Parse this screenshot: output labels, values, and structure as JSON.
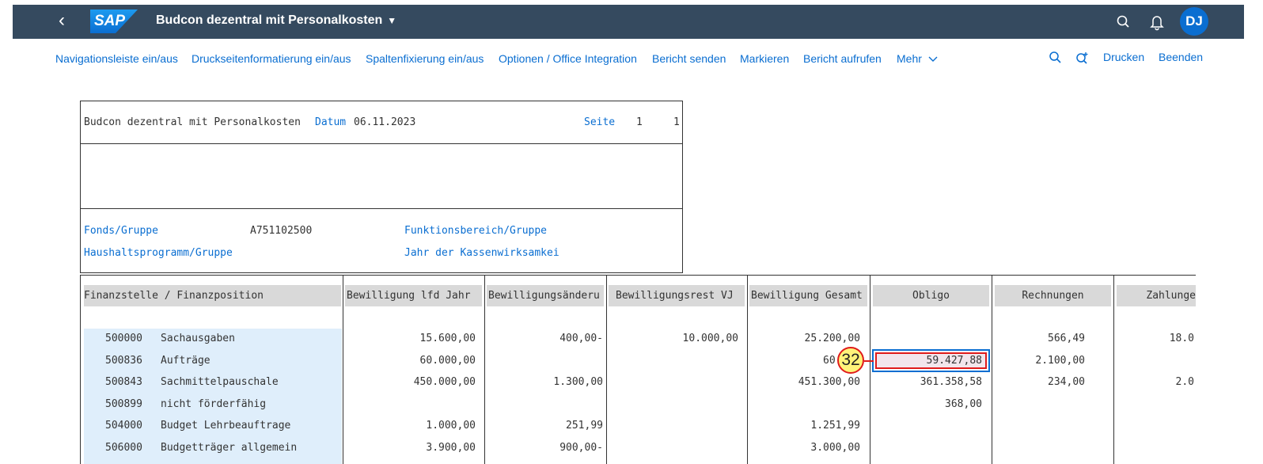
{
  "shell": {
    "logo_text": "SAP",
    "app_title": "Budcon dezentral mit Personalkosten",
    "user_initials": "DJ",
    "colors": {
      "shell_bg": "#354a5f",
      "avatar_bg": "#0a6ed1"
    }
  },
  "toolbar": {
    "items": [
      "Navigationsleiste ein/aus",
      "Druckseitenformatierung ein/aus",
      "Spaltenfixierung ein/aus",
      "Optionen / Office Integration",
      "Bericht senden",
      "Markieren",
      "Bericht aufrufen"
    ],
    "more_label": "Mehr",
    "print_label": "Drucken",
    "exit_label": "Beenden"
  },
  "report_header": {
    "title": "Budcon dezentral mit Personalkosten",
    "date_label": "Datum",
    "date_value": "06.11.2023",
    "page_label": "Seite",
    "page_current": "1",
    "page_total": "1",
    "fund_label": "Fonds/Gruppe",
    "fund_value": "A751102500",
    "functional_area_label": "Funktionsbereich/Gruppe",
    "budget_program_label": "Haushaltsprogramm/Gruppe",
    "cash_year_label": "Jahr der Kassenwirksamkei"
  },
  "table": {
    "columns": [
      "Finanzstelle / Finanzposition",
      "Bewilligung lfd Jahr",
      "Bewilligungsänderu",
      "Bewilligungsrest VJ",
      "Bewilligung Gesamt",
      "Obligo",
      "Rechnungen",
      "Zahlunge"
    ],
    "rows": [
      {
        "code": "500000",
        "name": "Sachausgaben",
        "bew_lfd": "15.600,00",
        "bew_aend": "400,00-",
        "bew_rest": "10.000,00",
        "bew_ges": "25.200,00",
        "obligo": "",
        "rechnungen": "566,49",
        "zahlungen": "18.0"
      },
      {
        "code": "500836",
        "name": "Aufträge",
        "bew_lfd": "60.000,00",
        "bew_aend": "",
        "bew_rest": "",
        "bew_ges": "60.000",
        "obligo": "59.427,88",
        "rechnungen": "2.100,00",
        "zahlungen": ""
      },
      {
        "code": "500843",
        "name": "Sachmittelpauschale",
        "bew_lfd": "450.000,00",
        "bew_aend": "1.300,00",
        "bew_rest": "",
        "bew_ges": "451.300,00",
        "obligo": "361.358,58",
        "rechnungen": "234,00",
        "zahlungen": "2.0"
      },
      {
        "code": "500899",
        "name": "nicht förderfähig",
        "bew_lfd": "",
        "bew_aend": "",
        "bew_rest": "",
        "bew_ges": "",
        "obligo": "368,00",
        "rechnungen": "",
        "zahlungen": ""
      },
      {
        "code": "504000",
        "name": "Budget Lehrbeauftrage",
        "bew_lfd": "1.000,00",
        "bew_aend": "251,99",
        "bew_rest": "",
        "bew_ges": "1.251,99",
        "obligo": "",
        "rechnungen": "",
        "zahlungen": ""
      },
      {
        "code": "506000",
        "name": "Budgetträger allgemein",
        "bew_lfd": "3.900,00",
        "bew_aend": "900,00-",
        "bew_rest": "",
        "bew_ges": "3.000,00",
        "obligo": "",
        "rechnungen": "",
        "zahlungen": ""
      }
    ]
  },
  "callout": {
    "number": "32"
  },
  "icons": [
    "back-icon",
    "search-icon",
    "bell-icon",
    "chevron-down-icon",
    "zoom-in-icon"
  ]
}
